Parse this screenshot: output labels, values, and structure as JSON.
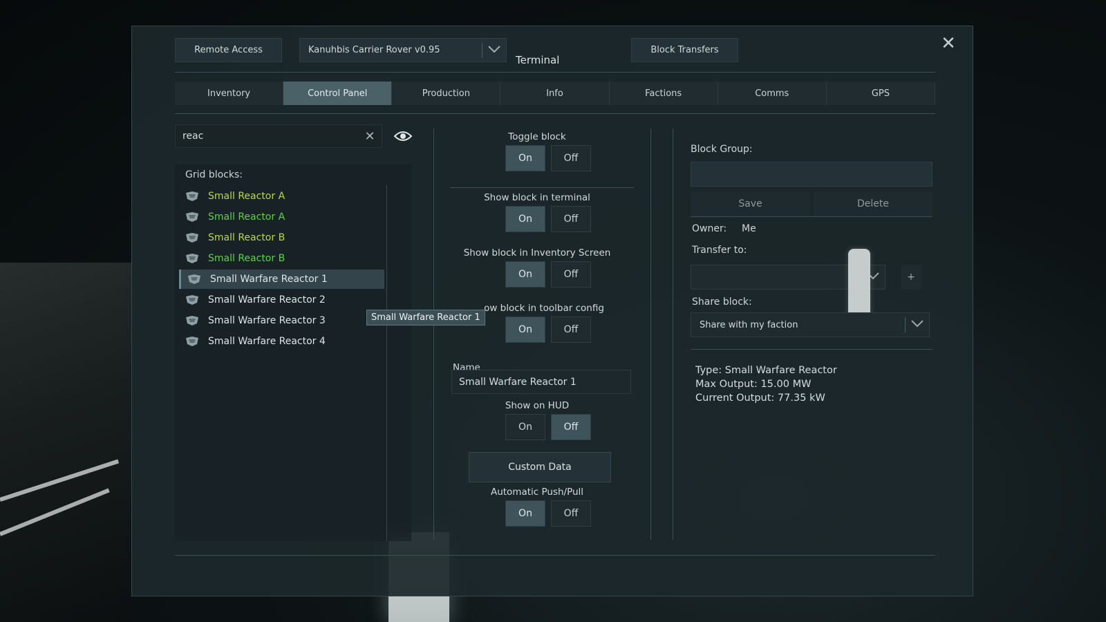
{
  "header": {
    "remote_access": "Remote Access",
    "grid_name": "Kanuhbis Carrier Rover v0.95",
    "title": "Terminal",
    "block_transfers": "Block Transfers"
  },
  "tabs": [
    {
      "label": "Inventory",
      "active": false
    },
    {
      "label": "Control Panel",
      "active": true
    },
    {
      "label": "Production",
      "active": false
    },
    {
      "label": "Info",
      "active": false
    },
    {
      "label": "Factions",
      "active": false
    },
    {
      "label": "Comms",
      "active": false
    },
    {
      "label": "GPS",
      "active": false
    }
  ],
  "search": {
    "value": "reac"
  },
  "grid_blocks": {
    "title": "Grid blocks:",
    "items": [
      {
        "label": "Small Reactor A",
        "color": "#b9d84a"
      },
      {
        "label": "Small Reactor A",
        "color": "#5fd14a"
      },
      {
        "label": "Small Reactor B",
        "color": "#b9d84a"
      },
      {
        "label": "Small Reactor B",
        "color": "#5fd14a"
      },
      {
        "label": "Small Warfare Reactor 1",
        "color": "#dfe5e6",
        "selected": true
      },
      {
        "label": "Small Warfare Reactor 2",
        "color": "#dfe5e6"
      },
      {
        "label": "Small Warfare Reactor 3",
        "color": "#dfe5e6"
      },
      {
        "label": "Small Warfare Reactor 4",
        "color": "#dfe5e6"
      }
    ]
  },
  "tooltip": "Small Warfare Reactor 1",
  "controls": {
    "toggle_block": {
      "label": "Toggle block",
      "on": "On",
      "off": "Off",
      "state": "on"
    },
    "show_terminal": {
      "label": "Show block in terminal",
      "on": "On",
      "off": "Off",
      "state": "on"
    },
    "show_inventory": {
      "label": "Show block in Inventory Screen",
      "on": "On",
      "off": "Off",
      "state": "on"
    },
    "show_toolbar": {
      "label": "ow block in toolbar config",
      "on": "On",
      "off": "Off",
      "state": "on"
    },
    "name_label": "Name",
    "name_value": "Small Warfare Reactor 1",
    "show_hud": {
      "label": "Show on HUD",
      "on": "On",
      "off": "Off",
      "state": "off"
    },
    "custom_data": "Custom Data",
    "push_pull": {
      "label": "Automatic Push/Pull",
      "on": "On",
      "off": "Off",
      "state": "on"
    }
  },
  "right": {
    "block_group_label": "Block Group:",
    "save": "Save",
    "delete": "Delete",
    "owner_label": "Owner:",
    "owner_value": "Me",
    "transfer_label": "Transfer to:",
    "transfer_value": "",
    "plus": "+",
    "share_label": "Share block:",
    "share_value": "Share with my faction",
    "type_line": "Type: Small Warfare Reactor",
    "max_output": "Max Output: 15.00 MW",
    "current_output": "Current Output: 77.35 kW"
  }
}
